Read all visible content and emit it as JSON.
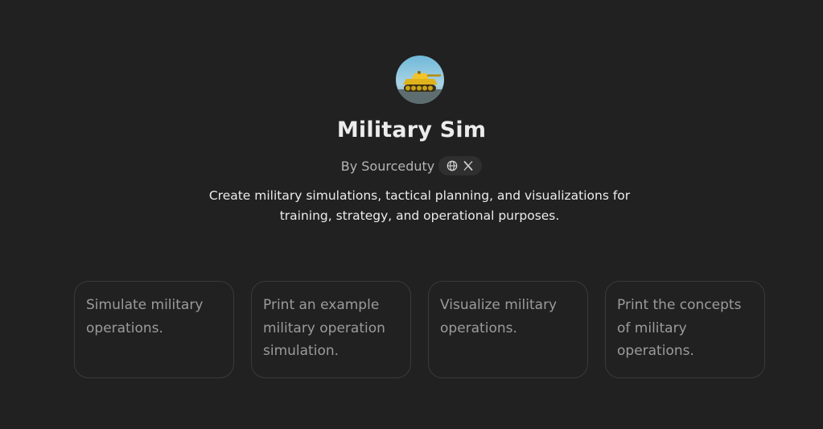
{
  "gpt": {
    "name": "Military Sim",
    "author": "By Sourceduty",
    "description": "Create military simulations, tactical planning, and visualizations for training, strategy, and operational purposes.",
    "avatar_icon": "tank-avatar",
    "social_icons": [
      "globe-icon",
      "x-logo-icon"
    ]
  },
  "conversation_starters": [
    {
      "label": "Simulate military operations."
    },
    {
      "label": "Print an example military operation simulation."
    },
    {
      "label": "Visualize military operations."
    },
    {
      "label": "Print the concepts of military operations."
    }
  ],
  "colors": {
    "background": "#212121",
    "card_border": "#3a3a3a",
    "text_primary": "#ececec",
    "text_muted": "#9b9b9b"
  }
}
